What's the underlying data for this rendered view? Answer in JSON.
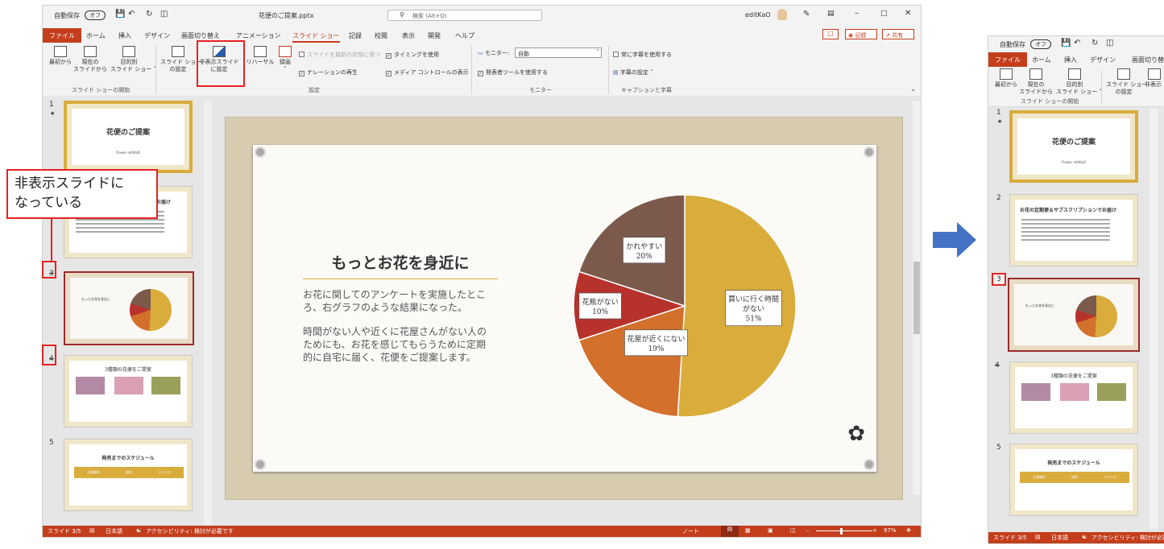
{
  "window": {
    "autosave": "自動保存",
    "autosave_state": "オフ",
    "filename": "花便のご提案.pptx",
    "search_placeholder": "検索 (Alt+Q)",
    "user": "editKaO"
  },
  "tabs": [
    "ファイル",
    "ホーム",
    "挿入",
    "デザイン",
    "画面切り替え",
    "アニメーション",
    "スライド ショー",
    "記録",
    "校閲",
    "表示",
    "開発",
    "ヘルプ"
  ],
  "tabs_short": [
    "ファイル",
    "ホーム",
    "挿入",
    "デザイン",
    "画面切り替"
  ],
  "header_buttons": {
    "record": "記録",
    "share": "共有"
  },
  "ribbon": {
    "from_start": "最初から",
    "from_current": [
      "現在の",
      "スライドから"
    ],
    "custom": [
      "目的別",
      "スライド ショー"
    ],
    "setup": [
      "スライド ショー",
      "の設定"
    ],
    "hide_slide": [
      "非表示スライド",
      "に設定"
    ],
    "rehearse": "リハーサル",
    "record": "録画",
    "keep_fresh": "スライドを最新の状態に保つ",
    "use_timings": "タイミングを使用",
    "narration": "ナレーションの再生",
    "media_controls": "メディア コントロールの表示",
    "monitor_label": "モニター:",
    "monitor_value": "自動",
    "presenter_view": "発表者ツールを使用する",
    "always_subtitles": "常に字幕を使用する",
    "subtitle_settings": "字幕の設定",
    "groups": {
      "start": "スライド ショーの開始",
      "setup": "設定",
      "monitor": "モニター",
      "captions": "キャプションと字幕"
    }
  },
  "right_ribbon": {
    "hide_partial": "非表示"
  },
  "slides": [
    {
      "num": "1",
      "title": "花便のご提案",
      "sub": "Flower editKaO"
    },
    {
      "num": "2",
      "title": "お花の定期便＆サブスクリプションでお届け"
    },
    {
      "num": "3",
      "title": "もっとお花を身近に"
    },
    {
      "num": "4",
      "title": "3種類の花便をご提案"
    },
    {
      "num": "5",
      "title": "発売までのスケジュール",
      "steps": [
        "企画制作",
        "試作",
        "リリース"
      ]
    }
  ],
  "main_slide": {
    "title": "もっとお花を身近に",
    "para1": "お花に関してのアンケートを実施したところ、右グラフのような結果になった。",
    "para2": "時間がない人や近くに花屋さんがない人のためにも、お花を感じてもらうために定期的に自宅に届く、花便をご提案します。"
  },
  "callout": [
    "非表示スライドに",
    "なっている"
  ],
  "chart_data": {
    "type": "pie",
    "categories": [
      "買いに行く時間がない",
      "花屋が近くにない",
      "花瓶がない",
      "かれやすい"
    ],
    "values": [
      51,
      19,
      10,
      20
    ],
    "labels": [
      [
        "買いに行く時間",
        "がない",
        "51%"
      ],
      [
        "花屋が近くにない",
        "19%"
      ],
      [
        "花瓶がない",
        "10%"
      ],
      [
        "かれやすい",
        "20%"
      ]
    ],
    "colors": [
      "#d9ac3c",
      "#d2702c",
      "#b8322c",
      "#7b5a4c"
    ]
  },
  "status": {
    "slide": "スライド 3/5",
    "lang": "日本語",
    "access": "アクセシビリティ: 検討が必要です",
    "notes": "ノート",
    "zoom": "97%"
  }
}
